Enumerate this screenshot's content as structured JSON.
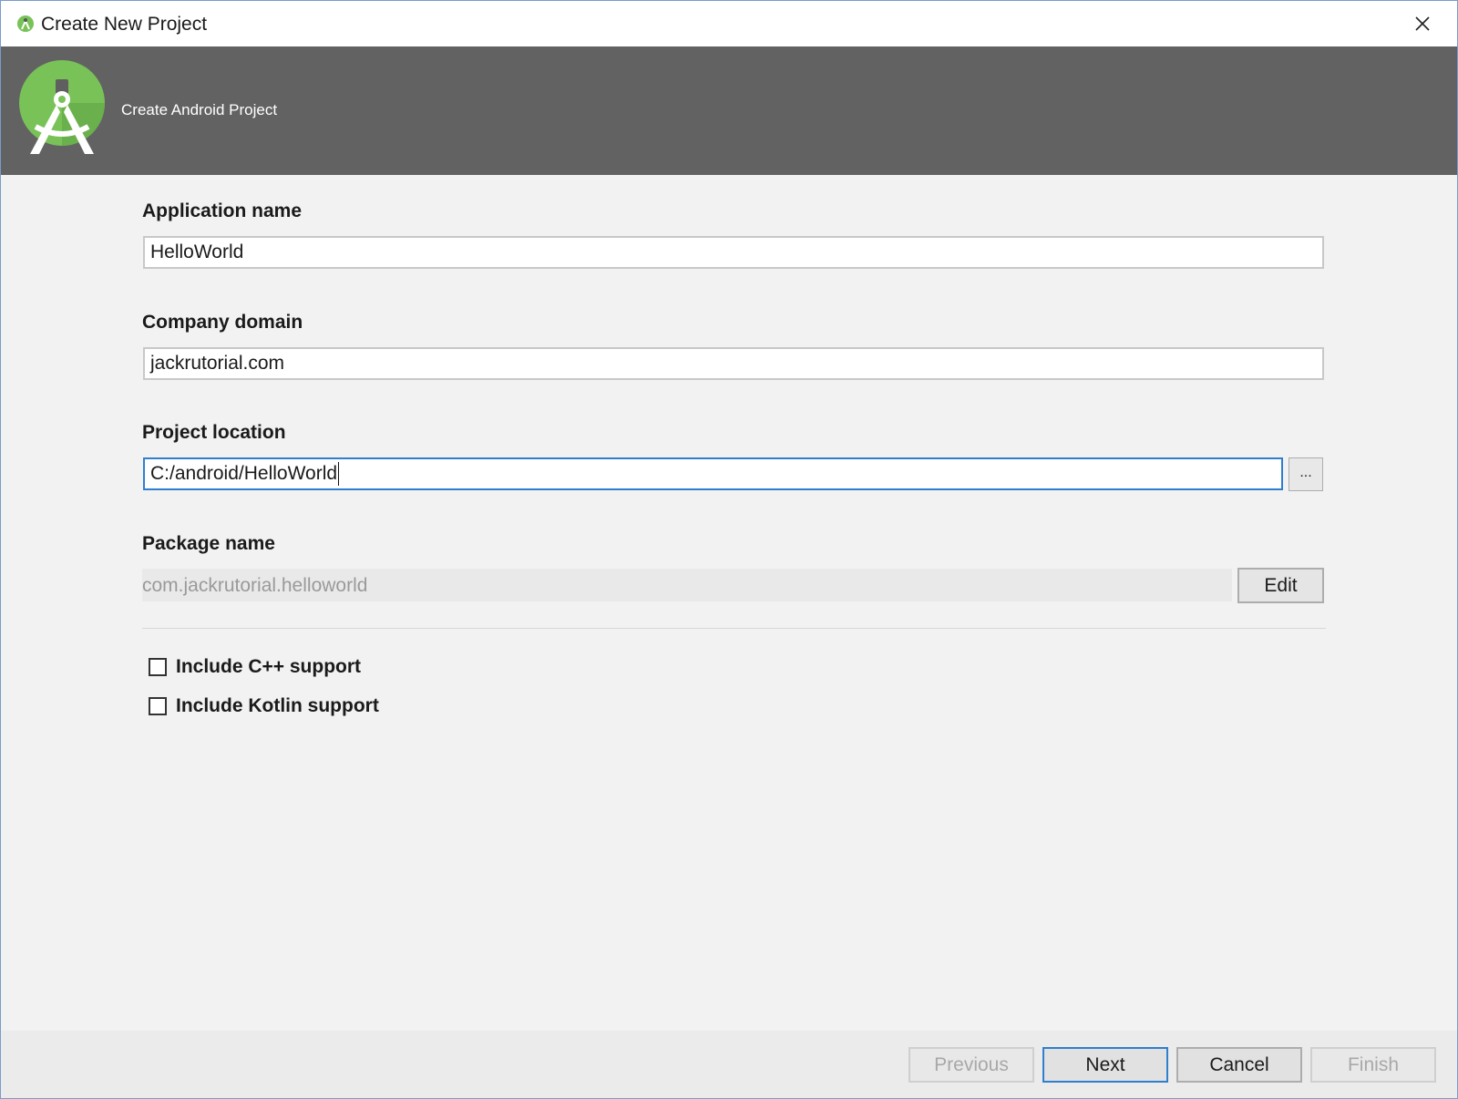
{
  "window": {
    "title": "Create New Project"
  },
  "banner": {
    "title": "Create Android Project"
  },
  "form": {
    "app_name": {
      "label": "Application name",
      "value": "HelloWorld"
    },
    "company_domain": {
      "label": "Company domain",
      "value": "jackrutorial.com"
    },
    "project_location": {
      "label": "Project location",
      "value": "C:/android/HelloWorld",
      "browse_label": "..."
    },
    "package_name": {
      "label": "Package name",
      "value": "com.jackrutorial.helloworld",
      "edit_label": "Edit"
    },
    "options": [
      {
        "label": "Include C++ support",
        "checked": false
      },
      {
        "label": "Include Kotlin support",
        "checked": false
      }
    ]
  },
  "footer": {
    "previous_label": "Previous",
    "next_label": "Next",
    "cancel_label": "Cancel",
    "finish_label": "Finish"
  },
  "colors": {
    "banner_bg": "#626262",
    "android_green": "#78c257",
    "focus_blue": "#2f7fcf"
  },
  "icons": {
    "app": "android-studio-icon",
    "close": "close-icon",
    "logo": "android-studio-logo"
  }
}
